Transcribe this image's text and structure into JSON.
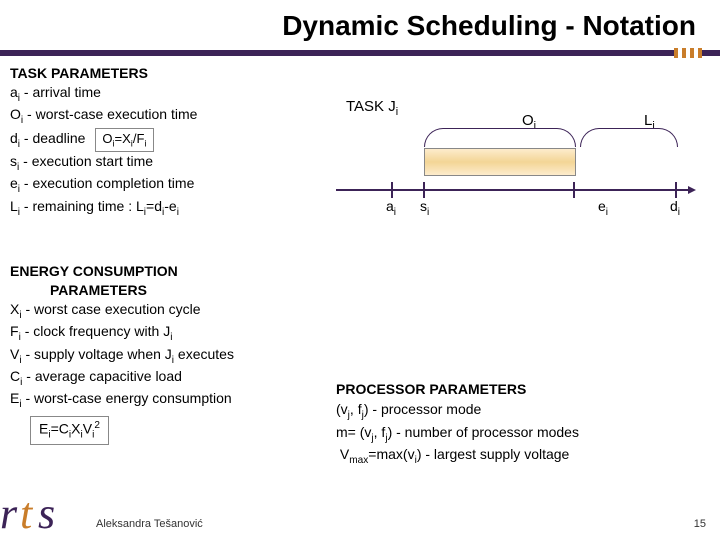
{
  "title": "Dynamic Scheduling - Notation",
  "task": {
    "header": "TASK PARAMETERS",
    "items": [
      {
        "sym": "a",
        "sub": "i",
        "desc": " - arrival time"
      },
      {
        "sym": "O",
        "sub": "i",
        "desc": " - worst-case execution time"
      },
      {
        "sym": "d",
        "sub": "i",
        "desc": " - deadline"
      },
      {
        "sym": "s",
        "sub": "i",
        "desc": " - execution start time"
      },
      {
        "sym": "e",
        "sub": "i",
        "desc": " - execution completion time"
      },
      {
        "sym": "L",
        "sub": "i",
        "desc": " - remaining time : L"
      }
    ],
    "eq_oi": "O",
    "eq_oi_rhs_a": "=X",
    "eq_oi_rhs_b": "/F",
    "li_tail": "=d",
    "li_tail2": "-e"
  },
  "diagram": {
    "task_label_a": "TASK J",
    "task_label_b": "i",
    "oi_a": "O",
    "oi_b": "i",
    "li_a": "L",
    "li_b": "i",
    "marks": {
      "a_a": "a",
      "a_b": "i",
      "s_a": "s",
      "s_b": "i",
      "e_a": "e",
      "e_b": "i",
      "d_a": "d",
      "d_b": "i"
    }
  },
  "energy": {
    "header": "ENERGY CONSUMPTION",
    "header2": "PARAMETERS",
    "items": [
      {
        "sym": "X",
        "sub": "i",
        "desc": " - worst case execution cycle"
      },
      {
        "sym": "F",
        "sub": "i",
        "desc": " - clock frequency with J",
        "tailsub": "i"
      },
      {
        "sym": "V",
        "sub": "i",
        "desc": " - supply voltage when J",
        "tailsub": "i",
        "tail2": " executes"
      },
      {
        "sym": "C",
        "sub": "i",
        "desc": " - average capacitive load"
      },
      {
        "sym": "E",
        "sub": "i",
        "desc": " - worst-case energy consumption"
      }
    ],
    "eq": {
      "a": "E",
      "b": "=C",
      "c": "X",
      "d": "V",
      "sup": "2"
    }
  },
  "proc": {
    "header": "PROCESSOR PARAMETERS",
    "l1a": "(v",
    "l1b": ", f",
    "l1c": ") - processor mode",
    "l2a": "m= (v",
    "l2b": ", f",
    "l2c": ") - number of processor modes",
    "l3a": "V",
    "l3b": "=max(v",
    "l3c": ") - largest supply voltage",
    "sub_j": "j",
    "sub_max": "max",
    "sub_i": "i"
  },
  "footer": {
    "name": "Aleksandra Tešanović",
    "page": "15"
  }
}
